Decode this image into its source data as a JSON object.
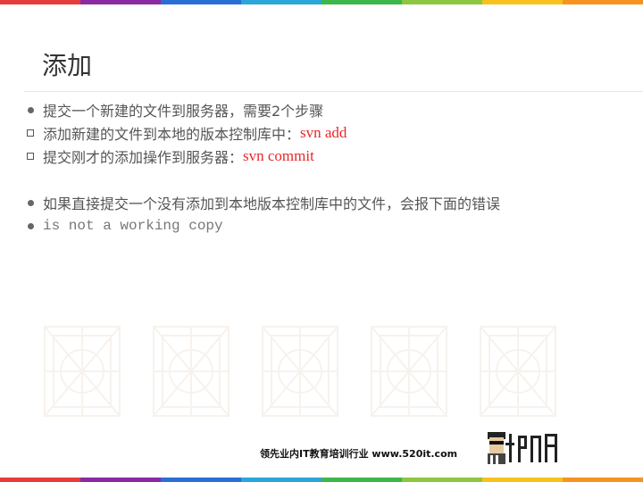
{
  "colors": {
    "stripe": [
      "#e63c3c",
      "#8a2aa3",
      "#2a6fd6",
      "#2aa7d6",
      "#3cb84a",
      "#8dc63f",
      "#f7c21c",
      "#f7931e",
      "#e63c3c"
    ],
    "accent_red": "#e8262a"
  },
  "slide": {
    "title": "添加",
    "items": [
      {
        "bullet": "dot",
        "text": "提交一个新建的文件到服务器，需要2个步骤",
        "code": ""
      },
      {
        "bullet": "square",
        "text": "添加新建的文件到本地的版本控制库中：",
        "code": "svn add"
      },
      {
        "bullet": "square",
        "text": "提交刚才的添加操作到服务器：",
        "code": "svn commit"
      },
      {
        "bullet": "dot",
        "text": "如果直接提交一个没有添加到本地版本控制库中的文件，会报下面的错误",
        "code": ""
      },
      {
        "bullet": "dot",
        "text": "is not a working copy",
        "code": ""
      }
    ]
  },
  "footer": {
    "slogan": "领先业内IT教育培训行业 www.520it.com",
    "logo_icon": "mascot-logo-icon"
  }
}
